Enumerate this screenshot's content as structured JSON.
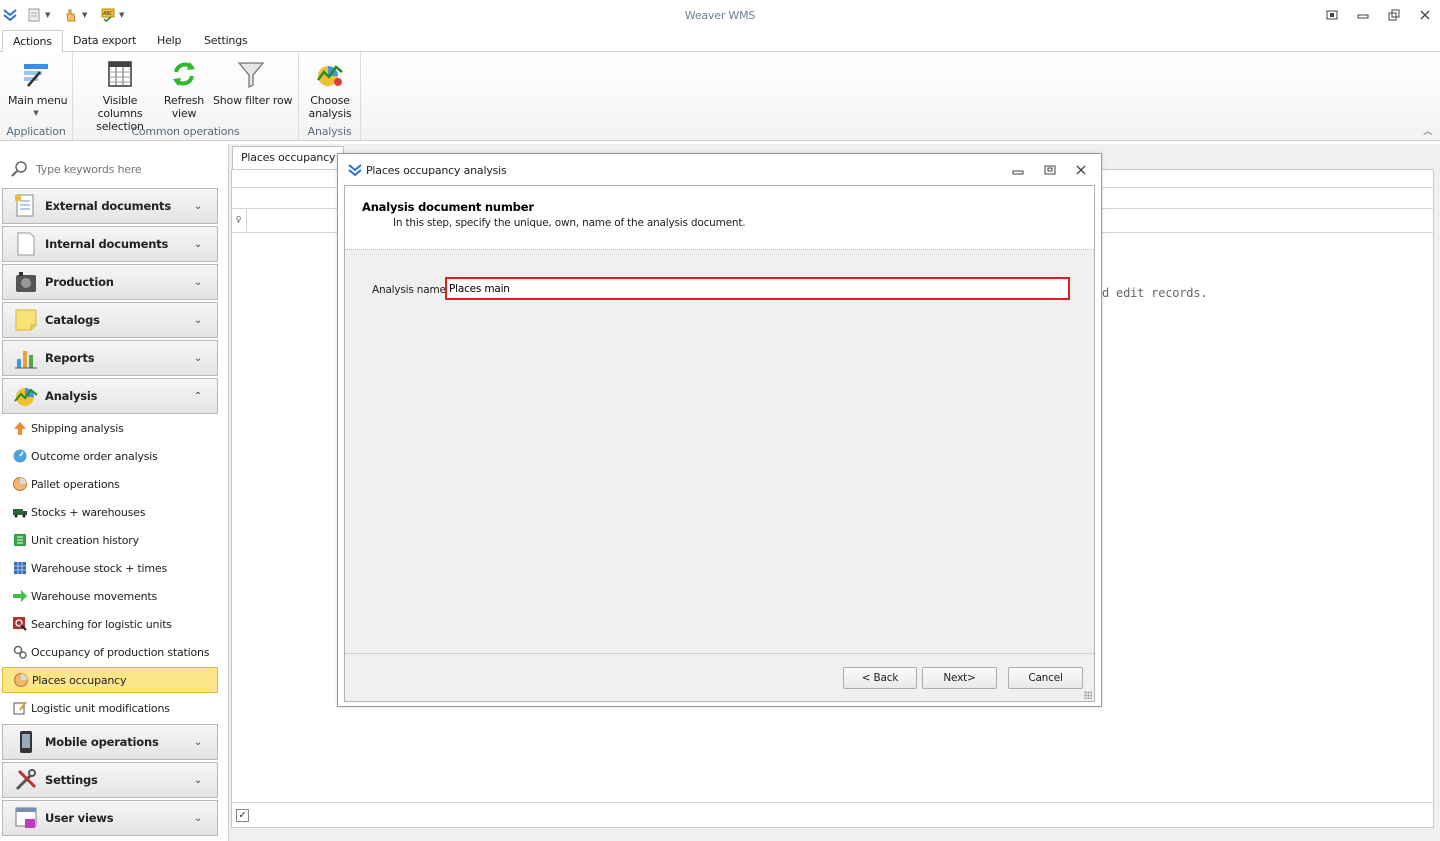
{
  "window": {
    "title": "Weaver WMS"
  },
  "menu": {
    "tabs": [
      "Actions",
      "Data export",
      "Help",
      "Settings"
    ]
  },
  "ribbon": {
    "groups": [
      {
        "label": "Application",
        "buttons": [
          {
            "label": "Main menu"
          }
        ]
      },
      {
        "label": "Common operations",
        "buttons": [
          {
            "label": "Visible columns selection"
          },
          {
            "label": "Refresh view"
          },
          {
            "label": "Show filter row"
          }
        ]
      },
      {
        "label": "Analysis",
        "buttons": [
          {
            "label": "Choose analysis"
          }
        ]
      }
    ]
  },
  "sidebar": {
    "search_placeholder": "Type keywords here",
    "groups": [
      {
        "label": "External documents",
        "icon": "document-icon"
      },
      {
        "label": "Internal documents",
        "icon": "page-icon"
      },
      {
        "label": "Production",
        "icon": "factory-icon"
      },
      {
        "label": "Catalogs",
        "icon": "note-icon"
      },
      {
        "label": "Reports",
        "icon": "bar-chart-icon"
      },
      {
        "label": "Analysis",
        "icon": "analysis-icon"
      },
      {
        "label": "Mobile operations",
        "icon": "mobile-icon"
      },
      {
        "label": "Settings",
        "icon": "tools-icon"
      },
      {
        "label": "User views",
        "icon": "user-views-icon"
      }
    ],
    "analysis_items": [
      {
        "label": "Shipping analysis",
        "icon": "up-arrow-icon"
      },
      {
        "label": "Outcome order analysis",
        "icon": "gauge-icon"
      },
      {
        "label": "Pallet operations",
        "icon": "pie-icon"
      },
      {
        "label": "Stocks + warehouses",
        "icon": "truck-icon"
      },
      {
        "label": "Unit creation history",
        "icon": "book-icon"
      },
      {
        "label": "Warehouse stock + times",
        "icon": "grid-icon"
      },
      {
        "label": "Warehouse movements",
        "icon": "right-arrow-icon"
      },
      {
        "label": "Searching for logistic units",
        "icon": "search-box-icon"
      },
      {
        "label": "Occupancy of production stations",
        "icon": "gears-icon"
      },
      {
        "label": "Places occupancy",
        "icon": "pie-icon",
        "selected": true
      },
      {
        "label": "Logistic unit modifications",
        "icon": "edit-icon"
      }
    ]
  },
  "main": {
    "tab_label": "Places occupancy",
    "empty_text": "d edit records."
  },
  "dialog": {
    "title": "Places occupancy analysis",
    "heading": "Analysis document number",
    "description": "In this step, specify the unique, own, name of the analysis document.",
    "field_label": "Analysis name",
    "field_value": "Places main",
    "back_label": "< Back",
    "next_label": "Next>",
    "cancel_label": "Cancel"
  },
  "colors": {
    "accent_blue": "#1e6fd9",
    "selected_bg": "#fde68a",
    "highlight_border": "#e02020"
  }
}
